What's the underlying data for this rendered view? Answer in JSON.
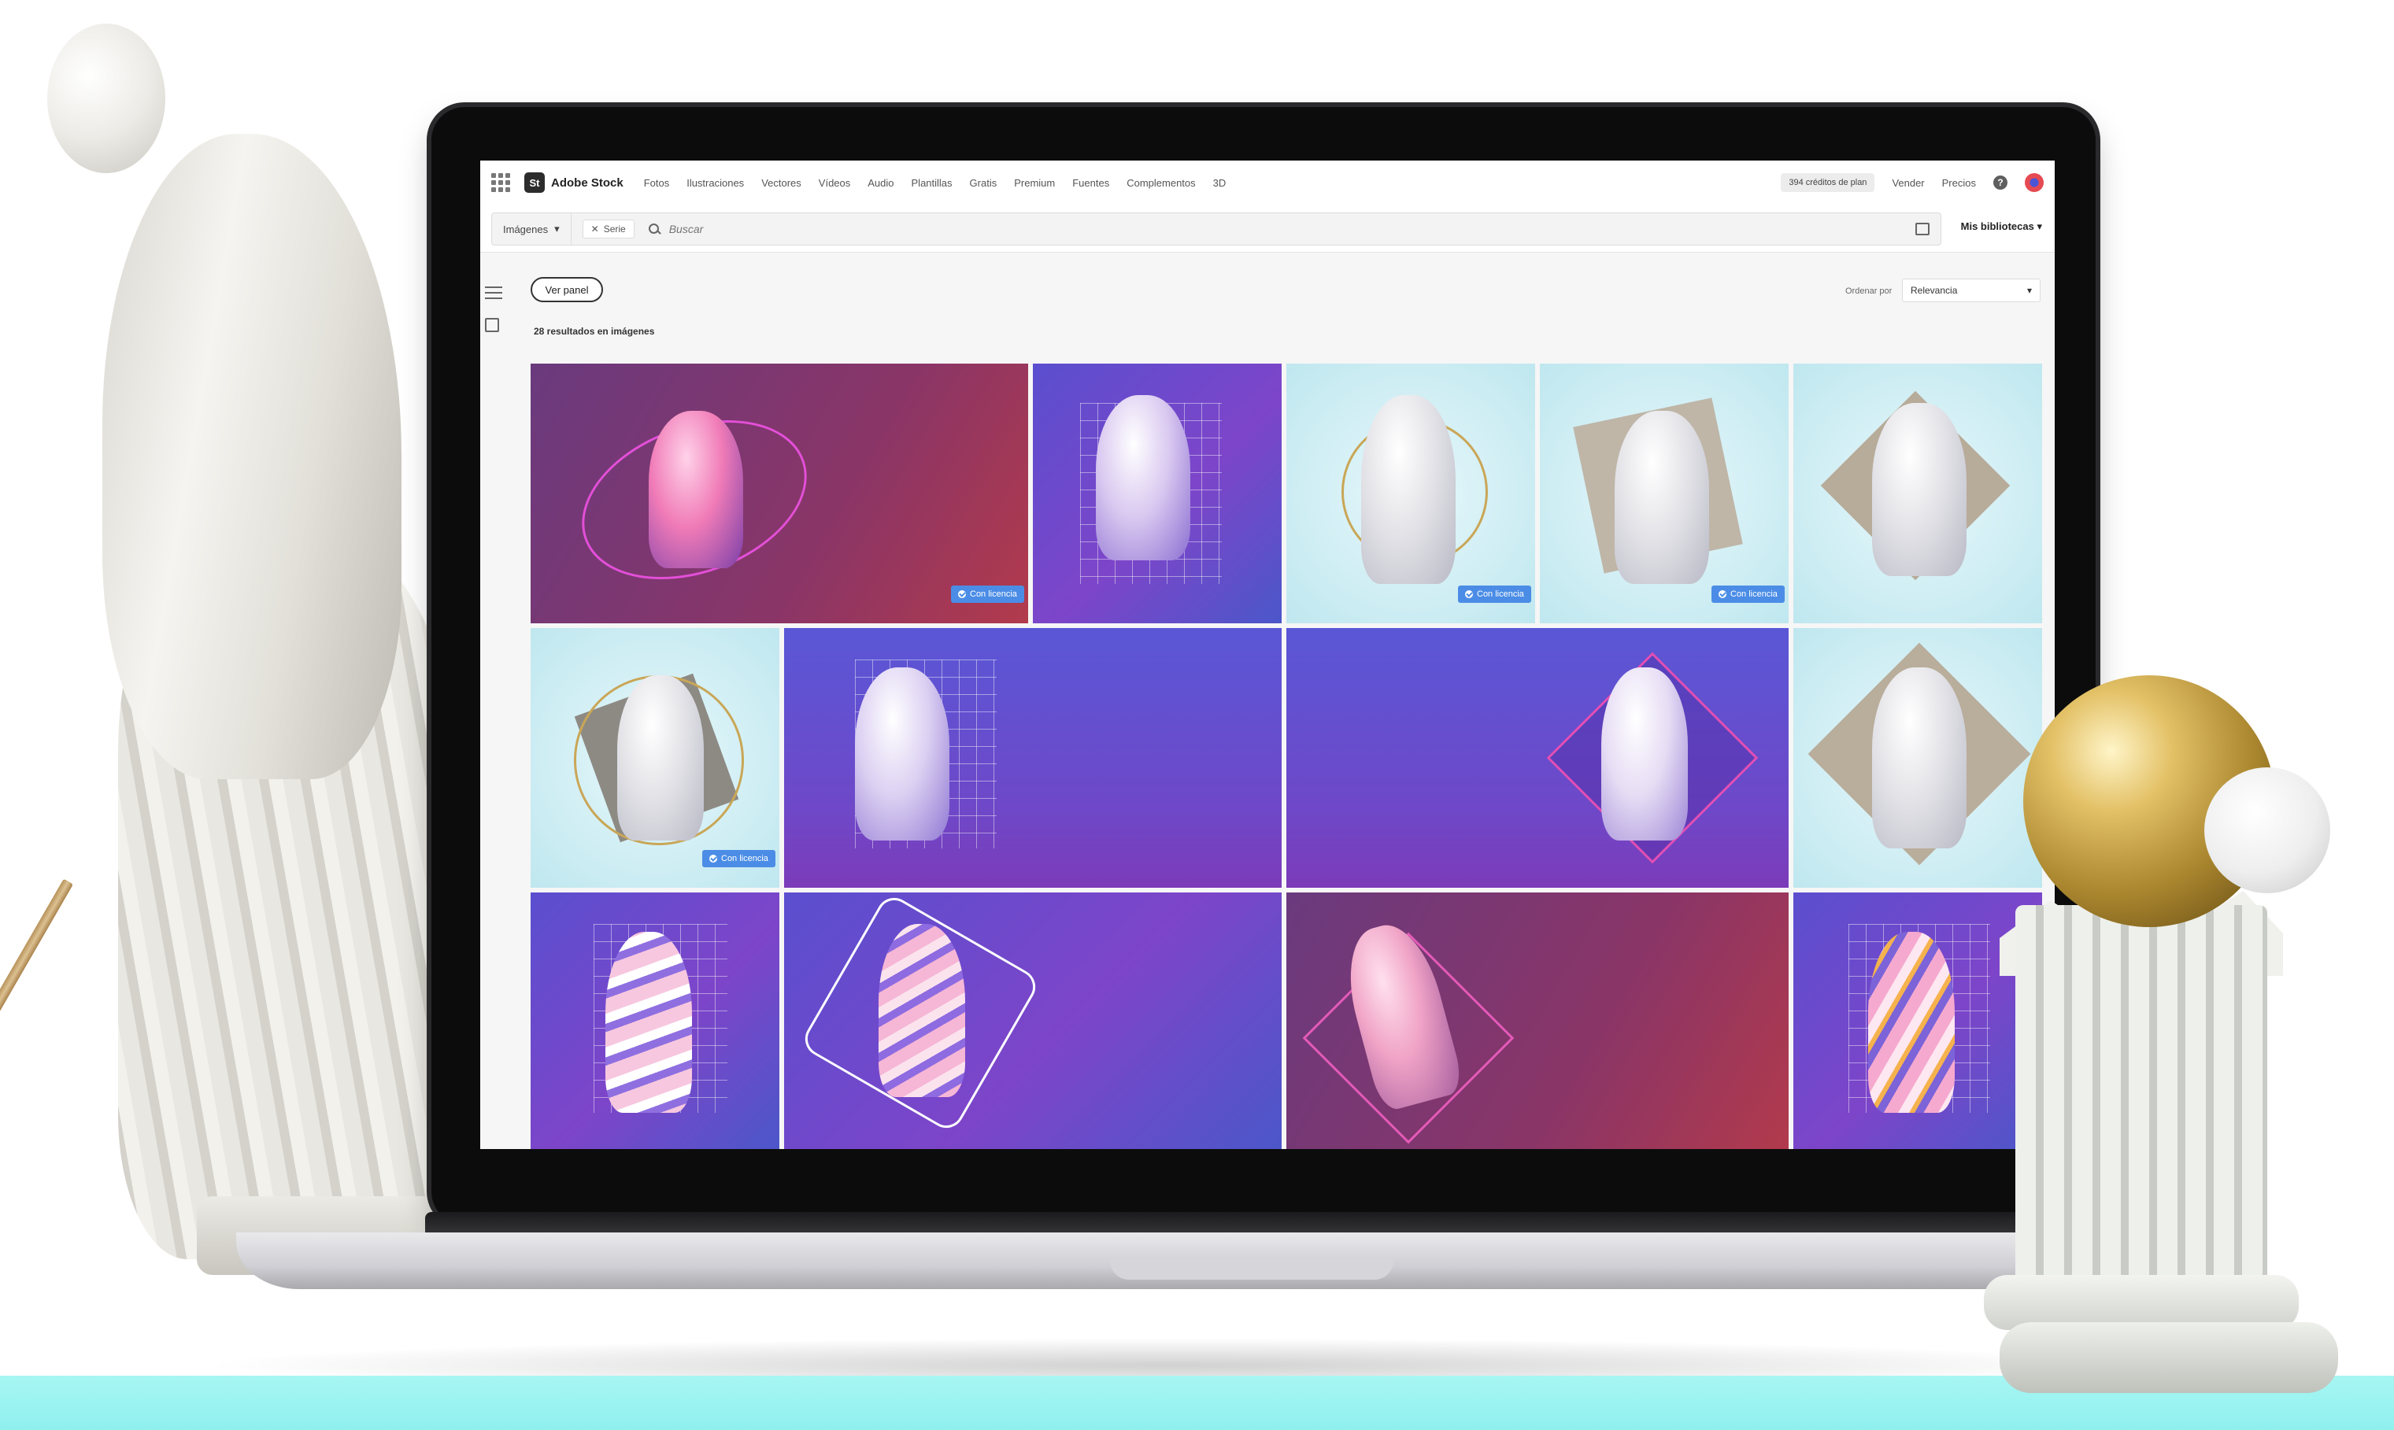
{
  "app": {
    "brand_badge": "St",
    "brand_name": "Adobe Stock"
  },
  "nav": {
    "links": [
      "Fotos",
      "Ilustraciones",
      "Vectores",
      "Vídeos",
      "Audio",
      "Plantillas",
      "Gratis",
      "Premium",
      "Fuentes",
      "Complementos",
      "3D"
    ],
    "credits": "394 créditos de plan",
    "sell": "Vender",
    "pricing": "Precios",
    "help": "?"
  },
  "search": {
    "type": "Imágenes",
    "chip": "Serie",
    "placeholder": "Buscar",
    "libraries": "Mis bibliotecas"
  },
  "content": {
    "panel_button": "Ver panel",
    "results_text": "28 resultados en imágenes",
    "sort_label": "Ordenar por",
    "sort_value": "Relevancia"
  },
  "tiles": {
    "licensed_label": "Con licencia"
  },
  "colors": {
    "badge_blue": "#4b8de6",
    "floor_cyan": "#a7f6f3"
  }
}
